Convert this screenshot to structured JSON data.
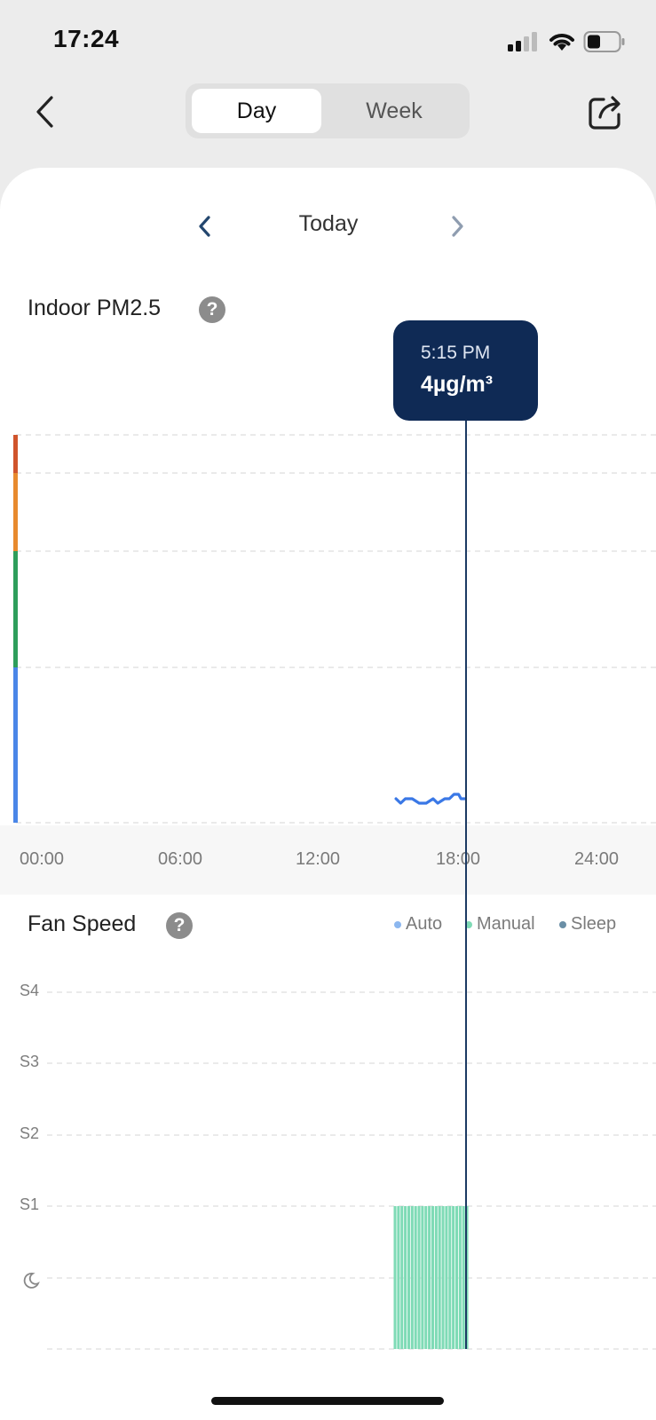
{
  "status_bar": {
    "time": "17:24"
  },
  "nav": {
    "tabs": [
      {
        "label": "Day",
        "selected": true
      },
      {
        "label": "Week",
        "selected": false
      }
    ]
  },
  "date_nav": {
    "label": "Today"
  },
  "pm25": {
    "title": "Indoor PM2.5",
    "help": "?",
    "tooltip": {
      "time": "5:15 PM",
      "value": "4µg/m³"
    },
    "level_colors": [
      "#4a86e8",
      "#2e9e5b",
      "#e88a2e",
      "#d0542c"
    ],
    "line_color": "#3a78e6"
  },
  "chart_data": [
    {
      "type": "line",
      "title": "Indoor PM2.5",
      "x_ticks": [
        "00:00",
        "06:00",
        "12:00",
        "18:00",
        "24:00"
      ],
      "xlim": [
        0,
        24
      ],
      "series": [
        {
          "values_x": [
            15.2,
            15.4,
            15.6,
            15.9,
            16.2,
            16.5,
            16.8,
            17.0,
            17.3,
            17.5,
            17.7,
            17.9,
            18.0,
            18.2
          ],
          "values_y": [
            4,
            3,
            4,
            4,
            3,
            3,
            4,
            3,
            4,
            4,
            5,
            5,
            4,
            4
          ]
        }
      ],
      "selected": {
        "time": "5:15 PM",
        "value": "4µg/m³"
      }
    },
    {
      "type": "bar",
      "title": "Fan Speed",
      "y_ticks": [
        "S4",
        "S3",
        "S2",
        "S1"
      ],
      "legend": [
        {
          "name": "Auto",
          "color": "#8cb7ef"
        },
        {
          "name": "Manual",
          "color": "#7fdbb6"
        },
        {
          "name": "Sleep",
          "color": "#6a8fa6"
        }
      ],
      "bars": {
        "start_hour": 15.1,
        "end_hour": 18.35,
        "level": "S1",
        "mode": "Manual",
        "count": 22
      }
    }
  ],
  "fan": {
    "title": "Fan Speed",
    "help": "?"
  }
}
